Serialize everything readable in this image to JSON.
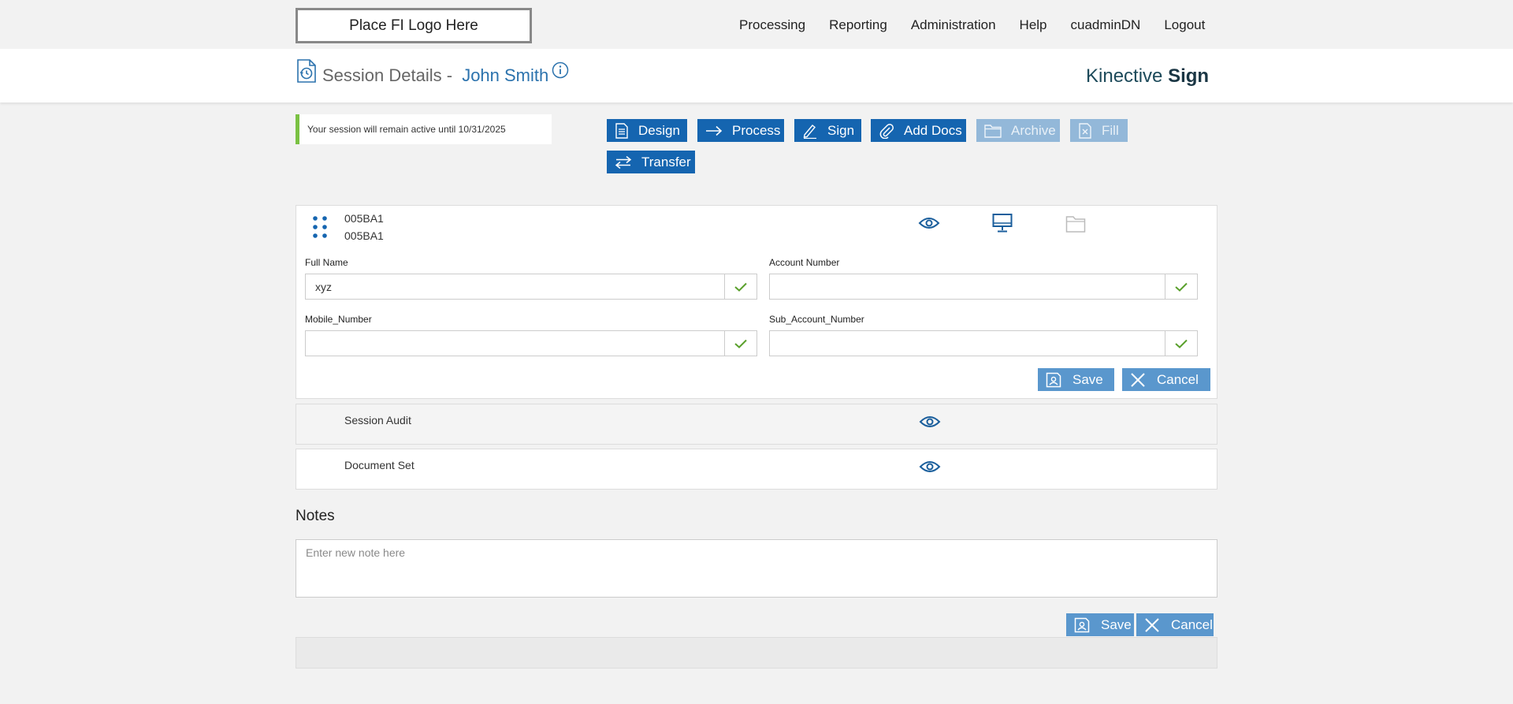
{
  "header": {
    "logo_text": "Place FI Logo Here",
    "nav": [
      "Processing",
      "Reporting",
      "Administration",
      "Help",
      "cuadminDN",
      "Logout"
    ]
  },
  "title": {
    "label": "Session Details - ",
    "user": "John Smith",
    "brand_light": "Kinective ",
    "brand_bold": "Sign"
  },
  "notice": {
    "text": "Your session will remain active until 10/31/2025",
    "accent_color": "#7ac143"
  },
  "actions": {
    "design": "Design",
    "process": "Process",
    "sign": "Sign",
    "add_docs": "Add Docs",
    "archive": "Archive",
    "fill": "Fill",
    "transfer": "Transfer",
    "disabled": [
      "Archive",
      "Fill"
    ]
  },
  "document": {
    "id_line1": "005BA1",
    "id_line2": "005BA1",
    "fields": {
      "full_name": {
        "label": "Full Name",
        "value": "xyz"
      },
      "account_number": {
        "label": "Account Number",
        "value": ""
      },
      "mobile_number": {
        "label": "Mobile_Number",
        "value": ""
      },
      "sub_account_number": {
        "label": "Sub_Account_Number",
        "value": ""
      }
    },
    "save_label": "Save",
    "cancel_label": "Cancel"
  },
  "rows": {
    "session_audit": "Session Audit",
    "document_set": "Document Set"
  },
  "notes": {
    "title": "Notes",
    "placeholder": "Enter new note here",
    "save_label": "Save",
    "cancel_label": "Cancel"
  },
  "colors": {
    "primary": "#1565b0",
    "disabled": "#93b8d9",
    "light_button": "#5a97cd",
    "check_green": "#5aa02c",
    "link_blue": "#2b72ad"
  }
}
